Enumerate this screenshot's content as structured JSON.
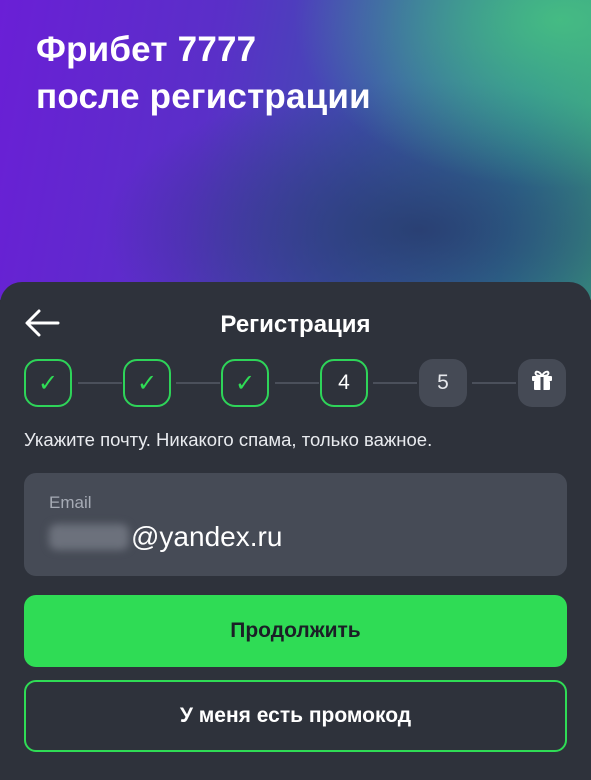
{
  "hero": {
    "title_line1": "Фрибет 7777",
    "title_line2": "после регистрации"
  },
  "sheet": {
    "title": "Регистрация",
    "back_icon": "arrow-left-icon",
    "steps": [
      {
        "label": "✓",
        "state": "done"
      },
      {
        "label": "✓",
        "state": "done"
      },
      {
        "label": "✓",
        "state": "done"
      },
      {
        "label": "4",
        "state": "active"
      },
      {
        "label": "5",
        "state": "pending"
      },
      {
        "label": "",
        "state": "pending",
        "icon": "gift-icon"
      }
    ],
    "hint": "Укажите почту. Никакого спама, только важное.",
    "email": {
      "label": "Email",
      "value_suffix": "@yandex.ru"
    },
    "continue_label": "Продолжить",
    "promo_label": "У меня есть промокод"
  },
  "colors": {
    "accent": "#2fdc55",
    "sheet_bg": "#2e323b",
    "field_bg": "#464b56",
    "step_pending_bg": "#454a55"
  }
}
